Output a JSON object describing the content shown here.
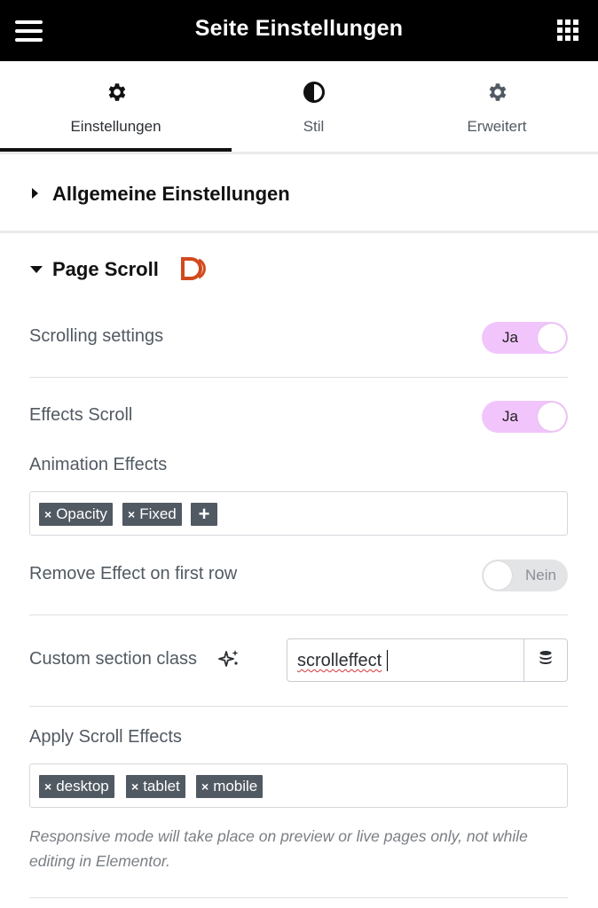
{
  "header": {
    "title": "Seite Einstellungen",
    "menu_icon": "hamburger-menu-icon",
    "apps_icon": "apps-grid-icon"
  },
  "tabs": [
    {
      "label": "Einstellungen",
      "icon": "gear-icon",
      "active": true
    },
    {
      "label": "Stil",
      "icon": "contrast-half-circle-icon",
      "active": false
    },
    {
      "label": "Erweitert",
      "icon": "gear-icon",
      "active": false
    }
  ],
  "sections": {
    "general": {
      "title": "Allgemeine Einstellungen",
      "expanded": false
    },
    "page_scroll": {
      "title": "Page Scroll",
      "badge_icon": "dynamic-ooo-logo-icon",
      "badge_color": "#d14a1c",
      "expanded": true
    }
  },
  "controls": {
    "scrolling_settings": {
      "label": "Scrolling settings",
      "state": "Ja"
    },
    "effects_scroll": {
      "label": "Effects Scroll",
      "state": "Ja"
    },
    "animation_effects": {
      "label": "Animation Effects",
      "tags": [
        "Opacity",
        "Fixed"
      ],
      "add_label": "+"
    },
    "remove_effect_first_row": {
      "label": "Remove Effect on first row",
      "state": "Nein"
    },
    "custom_section_class": {
      "label": "Custom section class",
      "ai_icon": "sparkle-ai-icon",
      "value": "scrolleffect",
      "dynamic_icon": "database-icon"
    },
    "apply_scroll_effects": {
      "label": "Apply Scroll Effects",
      "tags": [
        "desktop",
        "tablet",
        "mobile"
      ]
    }
  },
  "note": "Responsive mode will take place on preview or live pages only, not while editing in Elementor.",
  "colors": {
    "toggle_on": "#f1c5fb",
    "toggle_off": "#e3e4e6",
    "tag_bg": "#515962",
    "header_bg": "#000000"
  }
}
